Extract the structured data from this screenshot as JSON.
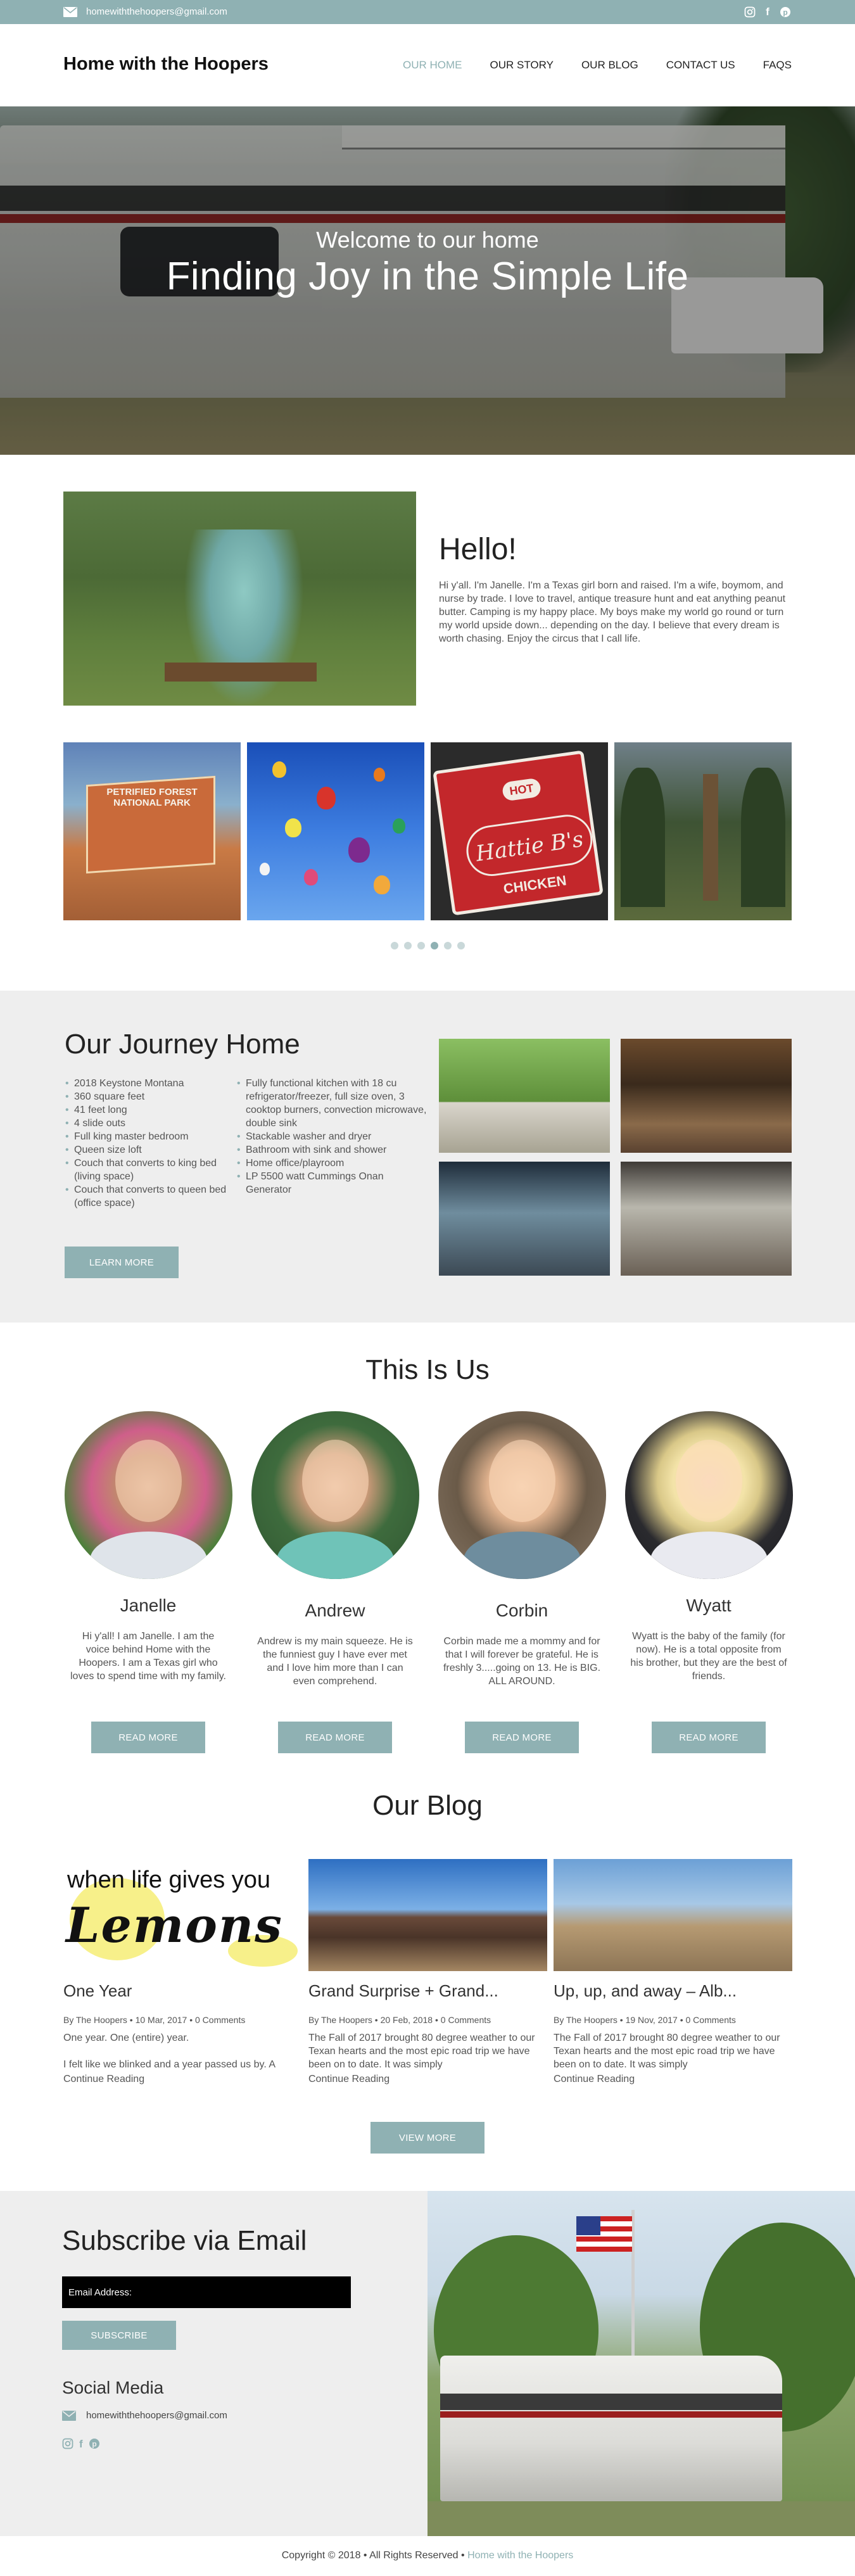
{
  "topbar": {
    "email": "homewiththehoopers@gmail.com",
    "social": [
      "instagram-icon",
      "facebook-icon",
      "pinterest-icon"
    ]
  },
  "header": {
    "brand": "Home with the Hoopers",
    "nav": [
      {
        "label": "OUR HOME",
        "active": true
      },
      {
        "label": "OUR STORY",
        "active": false
      },
      {
        "label": "OUR BLOG",
        "active": false
      },
      {
        "label": "CONTACT US",
        "active": false
      },
      {
        "label": "FAQS",
        "active": false
      }
    ]
  },
  "hero": {
    "line1": "Welcome to our home",
    "line2": "Finding Joy in the Simple Life"
  },
  "hello": {
    "title": "Hello!",
    "text": "Hi y'all. I'm Janelle. I'm a Texas girl born and raised. I'm a wife, boymom, and nurse by trade. I love to travel, antique treasure hunt and eat anything peanut butter. Camping is my happy place. My boys make my world go round or turn my world upside down... depending on the day. I believe that every dream is worth chasing. Enjoy the circus that I call life."
  },
  "carousel": {
    "sign_text": "PETRIFIED FOREST NATIONAL PARK",
    "hat_hot": "HOT",
    "hat_name": "Hattie B's",
    "hat_chicken": "CHICKEN",
    "dots": 6,
    "active_dot": 4
  },
  "journey": {
    "title": "Our Journey Home",
    "list1": [
      "2018 Keystone Montana",
      "360 square feet",
      "41 feet long",
      "4 slide outs",
      "Full king master bedroom",
      "Queen size loft",
      "Couch that converts to king bed (living space)",
      "Couch that converts to queen bed (office space)"
    ],
    "list2": [
      "Fully functional kitchen with 18 cu refrigerator/freezer, full size oven, 3 cooktop burners, convection microwave, double sink",
      "Stackable washer and dryer",
      "Bathroom with sink and shower",
      "Home office/playroom",
      "LP 5500 watt Cummings Onan Generator"
    ],
    "button": "LEARN MORE"
  },
  "us": {
    "title": "This Is Us",
    "members": [
      {
        "name": "Janelle",
        "bio": "Hi y'all!  I am Janelle.  I am the voice behind Home with the Hoopers.  I am a Texas girl who loves to spend time with my family.",
        "button": "READ MORE"
      },
      {
        "name": "Andrew",
        "bio": "Andrew is my main squeeze.  He is the funniest guy I have ever met and I love him more than I can even comprehend.",
        "button": "READ MORE"
      },
      {
        "name": "Corbin",
        "bio": "Corbin made me a mommy and for that I will forever be grateful.  He is freshly 3.....going on 13.  He is BIG.  ALL AROUND.",
        "button": "READ MORE"
      },
      {
        "name": "Wyatt",
        "bio": "Wyatt is the baby of the family (for now).  He is a total opposite from his brother, but they are the best of friends.",
        "button": "READ MORE"
      }
    ]
  },
  "blog": {
    "title": "Our Blog",
    "thumb1_line1": "when life gives you",
    "thumb1_line2": "Lemons",
    "posts": [
      {
        "title": "One Year",
        "meta": "By The Hoopers • 10 Mar, 2017 • 0 Comments",
        "excerpt": "One year.  One (entire) year.\n\nI felt like we blinked and a year passed us by.  A",
        "more": "Continue Reading"
      },
      {
        "title": "Grand Surprise + Grand...",
        "meta": "By The Hoopers • 20 Feb, 2018 • 0 Comments",
        "excerpt": "The Fall of 2017 brought 80 degree weather to our Texan hearts and the most epic road trip we have been on to date.  It was simply",
        "more": "Continue Reading"
      },
      {
        "title": "Up, up, and away – Alb...",
        "meta": "By The Hoopers • 19 Nov, 2017 • 0 Comments",
        "excerpt": "The Fall of 2017 brought 80 degree weather to our Texan hearts and the most epic road trip we have been on to date.  It was simply",
        "more": "Continue Reading"
      }
    ],
    "button": "VIEW MORE"
  },
  "subscribe": {
    "title": "Subscribe via Email",
    "placeholder": "Email Address:",
    "button": "SUBSCRIBE",
    "social_title": "Social Media",
    "email": "homewiththehoopers@gmail.com"
  },
  "footer": {
    "text": "Copyright © 2018 • All Rights Reserved • ",
    "link": "Home with the Hoopers"
  }
}
